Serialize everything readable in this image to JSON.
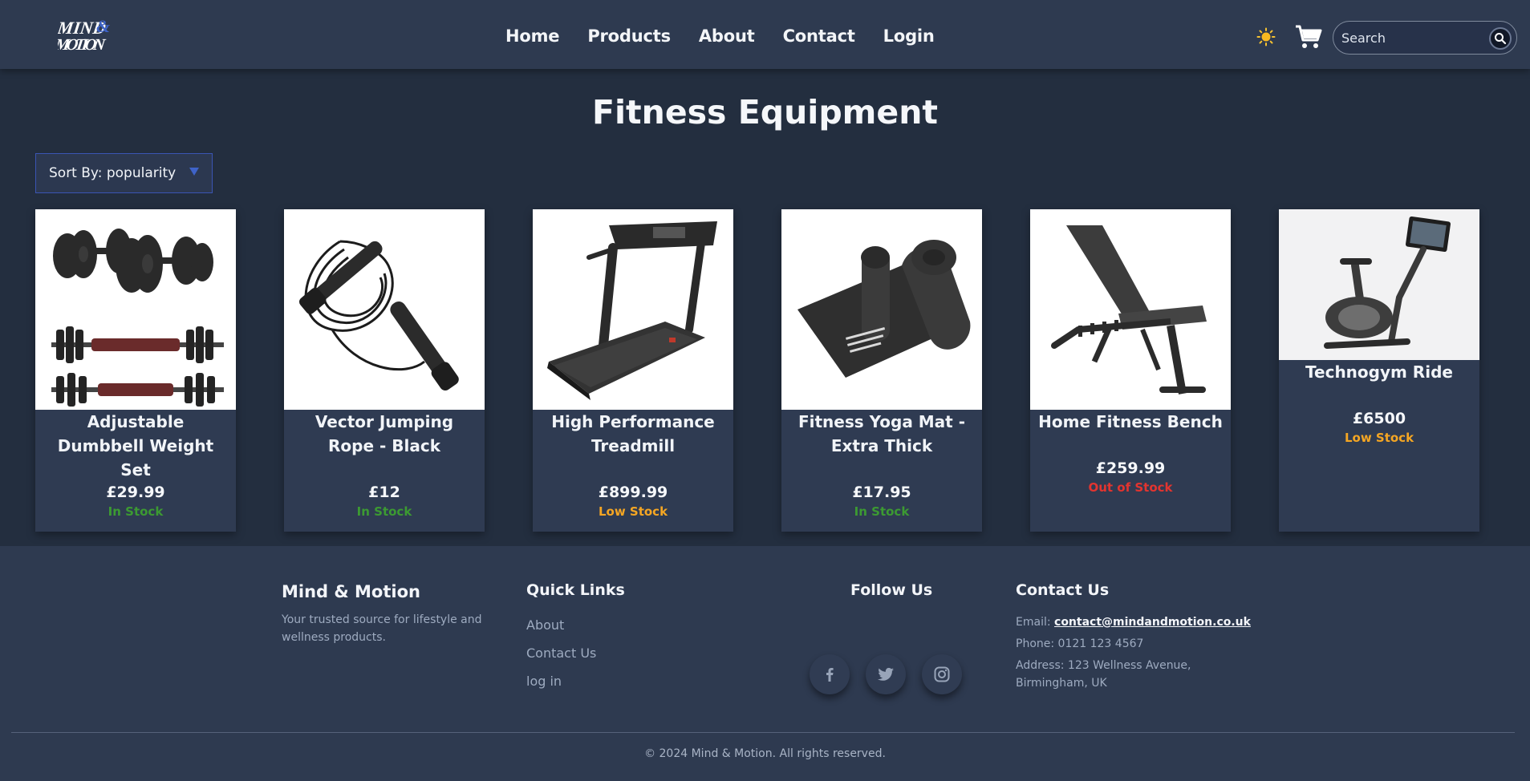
{
  "header": {
    "logo_text_top": "MIND",
    "logo_text_amp": "&",
    "logo_text_bottom": "MOTION",
    "nav": [
      {
        "label": "Home"
      },
      {
        "label": "Products"
      },
      {
        "label": "About"
      },
      {
        "label": "Contact"
      },
      {
        "label": "Login"
      }
    ],
    "theme_icon": "sun-icon",
    "cart_icon": "cart-icon",
    "search": {
      "placeholder": "Search",
      "value": "",
      "icon": "search-icon"
    }
  },
  "main": {
    "title": "Fitness Equipment",
    "sort": {
      "selected": "Sort By: popularity"
    },
    "products": [
      {
        "name": "Adjustable Dumbbell Weight Set",
        "price": "£29.99",
        "stock": "In Stock",
        "stock_color": "#3c9a32"
      },
      {
        "name": "Vector Jumping Rope - Black",
        "price": "£12",
        "stock": "In Stock",
        "stock_color": "#3c9a32"
      },
      {
        "name": "High Performance Treadmill",
        "price": "£899.99",
        "stock": "Low Stock",
        "stock_color": "#f5a623"
      },
      {
        "name": "Fitness Yoga Mat - Extra Thick",
        "price": "£17.95",
        "stock": "In Stock",
        "stock_color": "#3c9a32"
      },
      {
        "name": "Home Fitness Bench",
        "price": "£259.99",
        "stock": "Out of Stock",
        "stock_color": "#e3342f"
      },
      {
        "name": "Technogym Ride",
        "price": "£6500",
        "stock": "Low Stock",
        "stock_color": "#f5a623"
      }
    ]
  },
  "footer": {
    "brand": {
      "title": "Mind & Motion",
      "tagline": "Your trusted source for lifestyle and wellness products."
    },
    "quick_links": {
      "title": "Quick Links",
      "items": [
        "About",
        "Contact Us",
        "log in"
      ]
    },
    "follow": {
      "title": "Follow Us",
      "icons": [
        "facebook-icon",
        "twitter-icon",
        "instagram-icon"
      ]
    },
    "contact": {
      "title": "Contact Us",
      "email_label": "Email: ",
      "email": "contact@mindandmotion.co.uk",
      "phone": "Phone: 0121 123 4567",
      "address": "Address: 123 Wellness Avenue, Birmingham, UK"
    },
    "copyright": "© 2024 Mind & Motion. All rights reserved."
  }
}
